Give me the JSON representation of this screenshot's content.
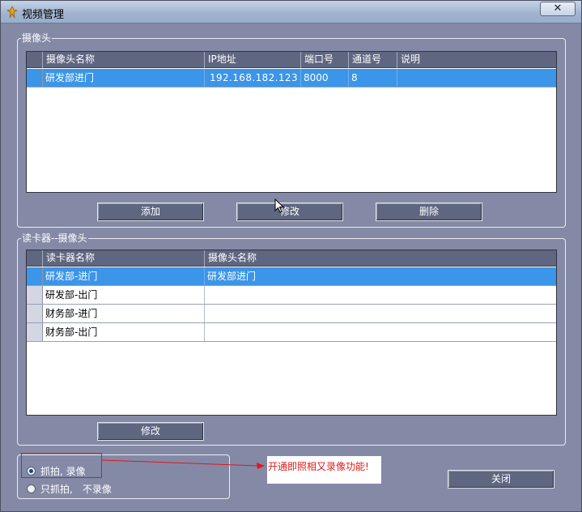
{
  "window": {
    "title": "视频管理",
    "close_label": "✕"
  },
  "camera_group": {
    "title": "摄像头",
    "columns": [
      "摄像头名称",
      "IP地址",
      "端口号",
      "通道号",
      "说明"
    ],
    "rows": [
      {
        "name": "研发部进门",
        "ip": "192.168.182.123",
        "port": "8000",
        "channel": "8",
        "note": ""
      }
    ],
    "buttons": {
      "add": "添加",
      "edit": "修改",
      "delete": "删除"
    }
  },
  "reader_group": {
    "title": "读卡器--摄像头",
    "columns": [
      "读卡器名称",
      "摄像头名称"
    ],
    "rows": [
      {
        "reader": "研发部-进门",
        "camera": "研发部进门"
      },
      {
        "reader": "研发部-出门",
        "camera": ""
      },
      {
        "reader": "财务部-进门",
        "camera": ""
      },
      {
        "reader": "财务部-出门",
        "camera": ""
      }
    ],
    "edit_label": "修改"
  },
  "mode": {
    "option1": "抓拍, 录像",
    "option2": "只抓拍,　不录像",
    "selected": "option1"
  },
  "annotation": {
    "note": "开通即照相又录像功能!"
  },
  "footer": {
    "close_button": "关闭"
  },
  "colors": {
    "selection": "#3b95e8",
    "panel": "#848aa6",
    "annotation": "#e31a1a"
  }
}
